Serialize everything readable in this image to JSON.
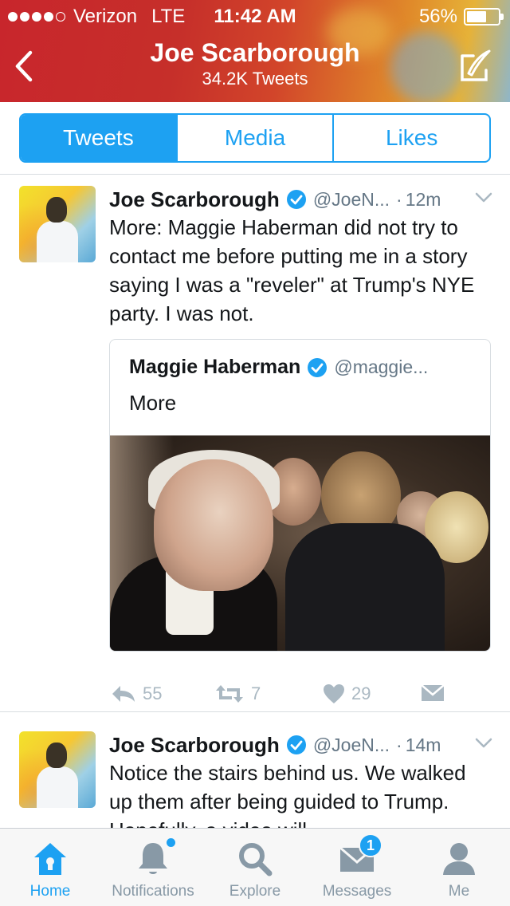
{
  "status_bar": {
    "carrier": "Verizon",
    "network": "LTE",
    "time": "11:42 AM",
    "battery": "56%"
  },
  "header": {
    "title": "Joe Scarborough",
    "subtitle": "34.2K Tweets"
  },
  "tabs": [
    {
      "label": "Tweets",
      "active": true
    },
    {
      "label": "Media",
      "active": false
    },
    {
      "label": "Likes",
      "active": false
    }
  ],
  "tweets": [
    {
      "name": "Joe Scarborough",
      "handle": "@JoeN...",
      "time": "12m",
      "text": "More: Maggie Haberman did not try to contact me before putting me in a story saying I was a \"reveler\" at Trump's NYE party. I was not.",
      "quote": {
        "name": "Maggie Haberman",
        "handle": "@maggie...",
        "text": "More"
      },
      "replies": "55",
      "retweets": "7",
      "likes": "29"
    },
    {
      "name": "Joe Scarborough",
      "handle": "@JoeN...",
      "time": "14m",
      "text": "Notice the stairs behind us. We walked up them after being guided to Trump. Hopefully, a video will"
    }
  ],
  "tabbar": [
    {
      "label": "Home",
      "icon": "home-icon",
      "active": true
    },
    {
      "label": "Notifications",
      "icon": "bell-icon",
      "active": false
    },
    {
      "label": "Explore",
      "icon": "search-icon",
      "active": false
    },
    {
      "label": "Messages",
      "icon": "envelope-icon",
      "active": false,
      "badge": "1"
    },
    {
      "label": "Me",
      "icon": "person-icon",
      "active": false
    }
  ],
  "colors": {
    "accent": "#1da1f2",
    "muted": "#657786",
    "action_gray": "#aab8c2"
  }
}
